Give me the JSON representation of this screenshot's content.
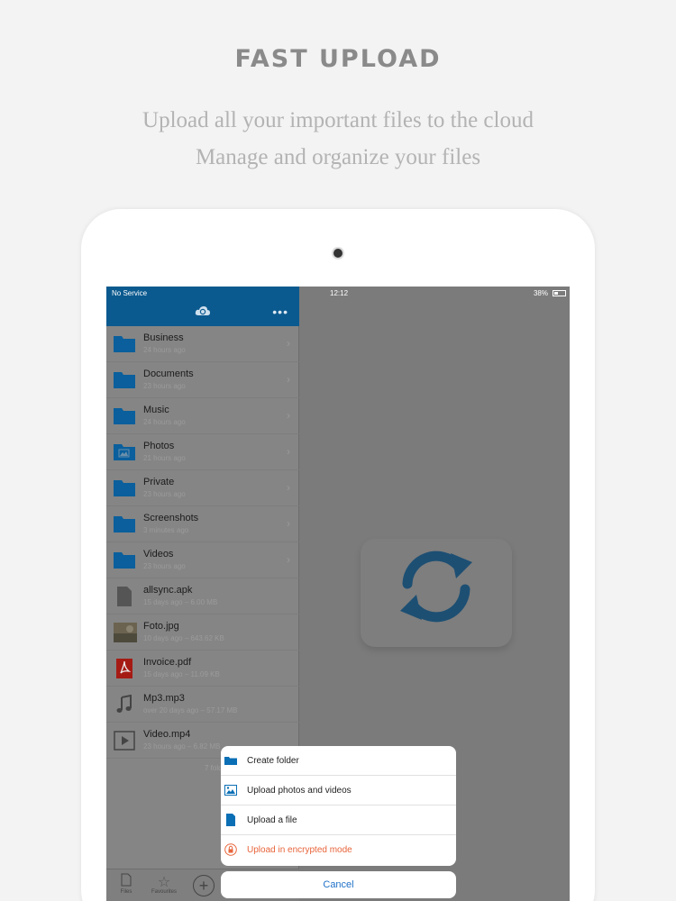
{
  "promo": {
    "headline": "FAST UPLOAD",
    "tagline_1": "Upload all your important files to the cloud",
    "tagline_2": "Manage and organize your files"
  },
  "status_bar": {
    "carrier": "No Service",
    "time": "12:12",
    "battery": "38%"
  },
  "nav": {
    "logo_icon": "cloud-sync-icon",
    "more_icon": "more-dots-icon"
  },
  "files": [
    {
      "name": "Business",
      "meta": "24 hours ago",
      "icon": "folder-icon",
      "chevron": true
    },
    {
      "name": "Documents",
      "meta": "23 hours ago",
      "icon": "folder-icon",
      "chevron": true
    },
    {
      "name": "Music",
      "meta": "24 hours ago",
      "icon": "folder-icon",
      "chevron": true
    },
    {
      "name": "Photos",
      "meta": "21 hours ago",
      "icon": "photo-folder-icon",
      "chevron": true
    },
    {
      "name": "Private",
      "meta": "23 hours ago",
      "icon": "folder-icon",
      "chevron": true
    },
    {
      "name": "Screenshots",
      "meta": "3 minutes ago",
      "icon": "folder-icon",
      "chevron": true
    },
    {
      "name": "Videos",
      "meta": "23 hours ago",
      "icon": "folder-icon",
      "chevron": true
    },
    {
      "name": "allsync.apk",
      "meta": "15 days ago – 6.00 MB",
      "icon": "file-icon",
      "chevron": false
    },
    {
      "name": "Foto.jpg",
      "meta": "10 days ago – 643.62 KB",
      "icon": "image-thumb-icon",
      "chevron": false
    },
    {
      "name": "Invoice.pdf",
      "meta": "15 days ago – 11.09 KB",
      "icon": "pdf-icon",
      "chevron": false
    },
    {
      "name": "Mp3.mp3",
      "meta": "over 20 days ago – 57.17 MB",
      "icon": "music-note-icon",
      "chevron": false
    },
    {
      "name": "Video.mp4",
      "meta": "23 hours ago – 6.82 MB",
      "icon": "video-play-icon",
      "chevron": false
    }
  ],
  "list_footer": "7 folders, 5 files",
  "tabs": [
    {
      "label": "Files",
      "icon": "file-tab-icon"
    },
    {
      "label": "Favourites",
      "icon": "star-icon"
    }
  ],
  "action_sheet": {
    "items": [
      {
        "label": "Create folder",
        "icon": "folder-icon"
      },
      {
        "label": "Upload photos and videos",
        "icon": "image-icon"
      },
      {
        "label": "Upload a file",
        "icon": "file-icon"
      },
      {
        "label": "Upload in encrypted mode",
        "icon": "lock-icon"
      }
    ],
    "cancel": "Cancel"
  },
  "colors": {
    "brand_blue": "#0b5a8f",
    "folder_blue": "#0a5f9c",
    "danger": "#e8643a",
    "link_blue": "#1f71c8"
  }
}
